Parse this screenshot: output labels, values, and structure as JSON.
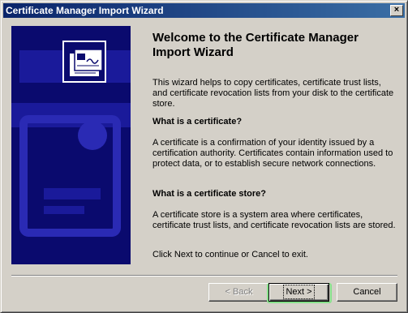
{
  "window": {
    "title": "Certificate Manager Import Wizard",
    "close_label": "×"
  },
  "main": {
    "heading": "Welcome to the Certificate Manager Import Wizard",
    "intro": "This wizard helps to copy certificates, certificate trust lists, and certificate revocation lists from your disk to the certificate store.",
    "q1": "What is a certificate?",
    "a1": "A certificate is a confirmation of your identity issued by a certification authority.  Certificates contain information used to protect data, or to establish secure network connections.",
    "q2": "What is a certificate store?",
    "a2": "A certificate store is a system area where certificates, certificate trust lists, and certificate revocation lists are stored.",
    "footer": "Click Next to continue or Cancel to exit."
  },
  "buttons": {
    "back": "< Back",
    "next": "Next >",
    "cancel": "Cancel"
  },
  "icons": {
    "banner": "certificate-icon"
  },
  "colors": {
    "titlebar": "#0a246a",
    "banner": "#0a0a6e"
  }
}
